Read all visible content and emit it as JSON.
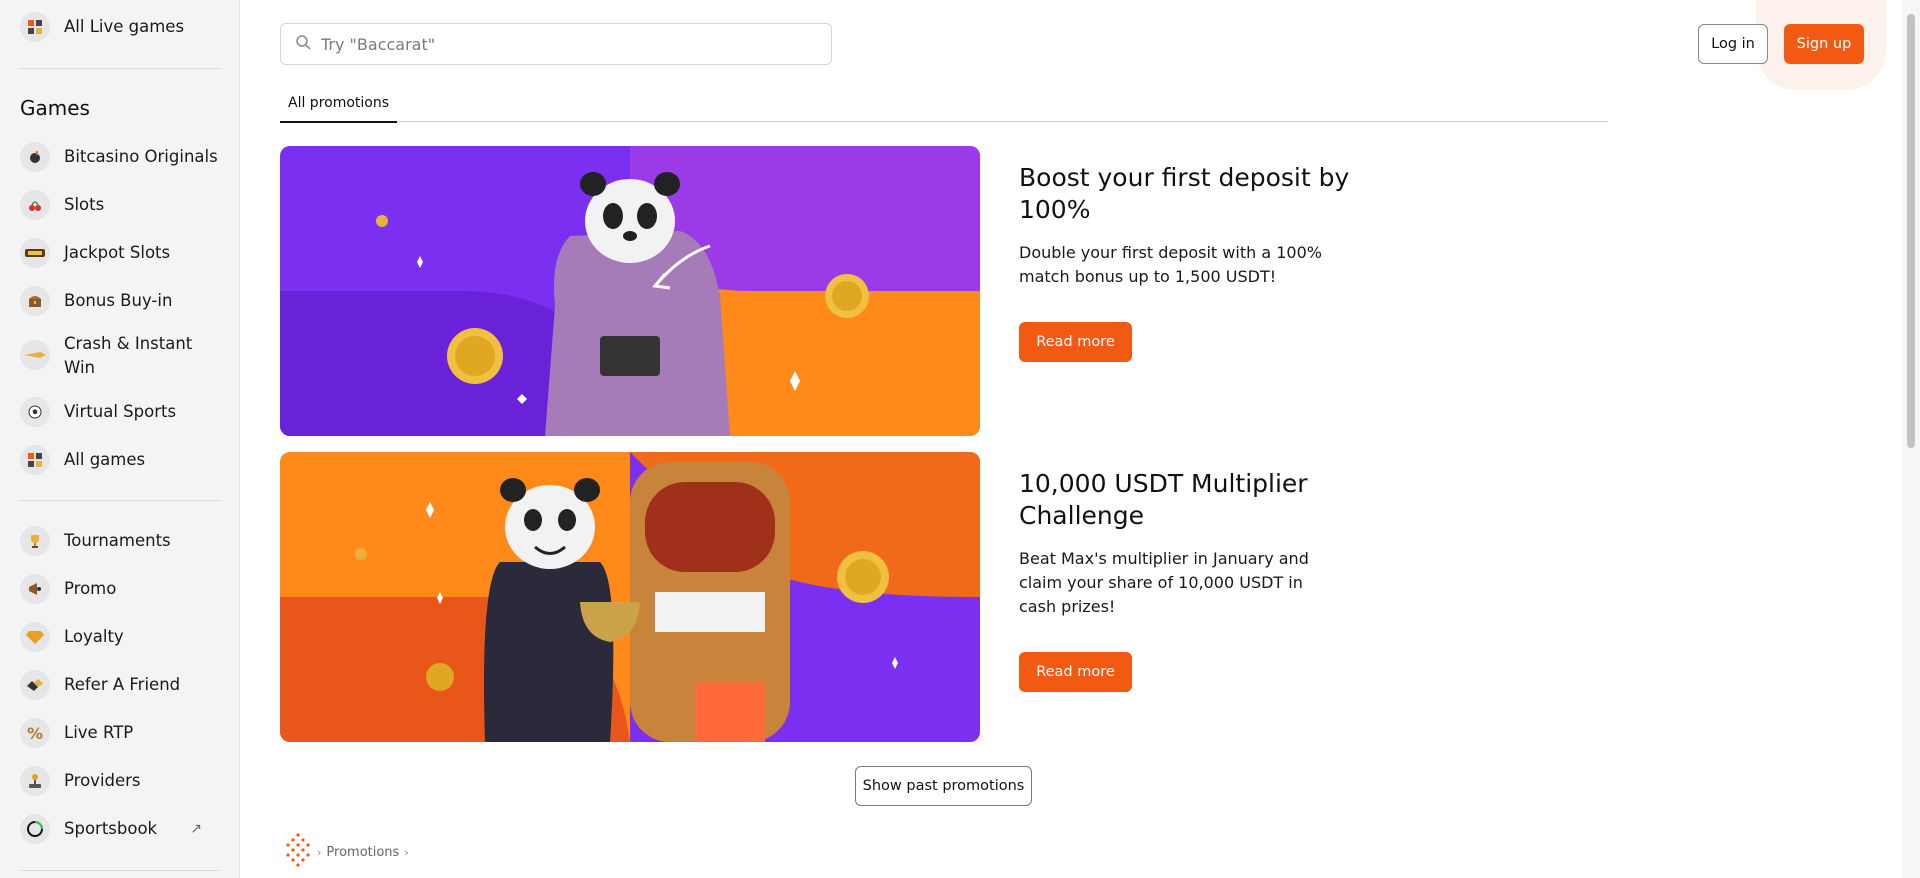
{
  "sidebar": {
    "top_item": {
      "label": "All Live games",
      "icon": "grid-icon"
    },
    "games_title": "Games",
    "games": [
      {
        "label": "Bitcasino Originals",
        "icon": "bomb-icon"
      },
      {
        "label": "Slots",
        "icon": "cherries-icon"
      },
      {
        "label": "Jackpot Slots",
        "icon": "jackpot-icon"
      },
      {
        "label": "Bonus Buy-in",
        "icon": "treasure-chest-icon"
      },
      {
        "label": "Crash & Instant Win",
        "icon": "rocket-icon"
      },
      {
        "label": "Virtual Sports",
        "icon": "football-icon"
      },
      {
        "label": "All games",
        "icon": "grid-icon"
      }
    ],
    "extras": [
      {
        "label": "Tournaments",
        "icon": "trophy-icon"
      },
      {
        "label": "Promo",
        "icon": "megaphone-icon"
      },
      {
        "label": "Loyalty",
        "icon": "diamond-icon"
      },
      {
        "label": "Refer A Friend",
        "icon": "handshake-icon"
      },
      {
        "label": "Live RTP",
        "icon": "percent-icon"
      },
      {
        "label": "Providers",
        "icon": "joystick-icon"
      },
      {
        "label": "Sportsbook",
        "icon": "sportsbook-icon",
        "external": "↗"
      }
    ]
  },
  "header": {
    "search_placeholder": "Try \"Baccarat\"",
    "login_label": "Log in",
    "signup_label": "Sign up"
  },
  "tabs": [
    {
      "label": "All promotions"
    }
  ],
  "promotions": [
    {
      "title": "Boost your first deposit by 100%",
      "description": "Double your first deposit with a 100% match bonus up to 1,500 USDT!",
      "button": "Read more"
    },
    {
      "title": "10,000 USDT Multiplier Challenge",
      "description": "Beat Max's multiplier in January and claim your share of 10,000 USDT in cash prizes!",
      "button": "Read more"
    }
  ],
  "show_past_label": "Show past promotions",
  "breadcrumb": {
    "current": "Promotions"
  },
  "colors": {
    "accent": "#f25a13",
    "purple": "#7b2ff0",
    "orange": "#ff8a1a"
  }
}
